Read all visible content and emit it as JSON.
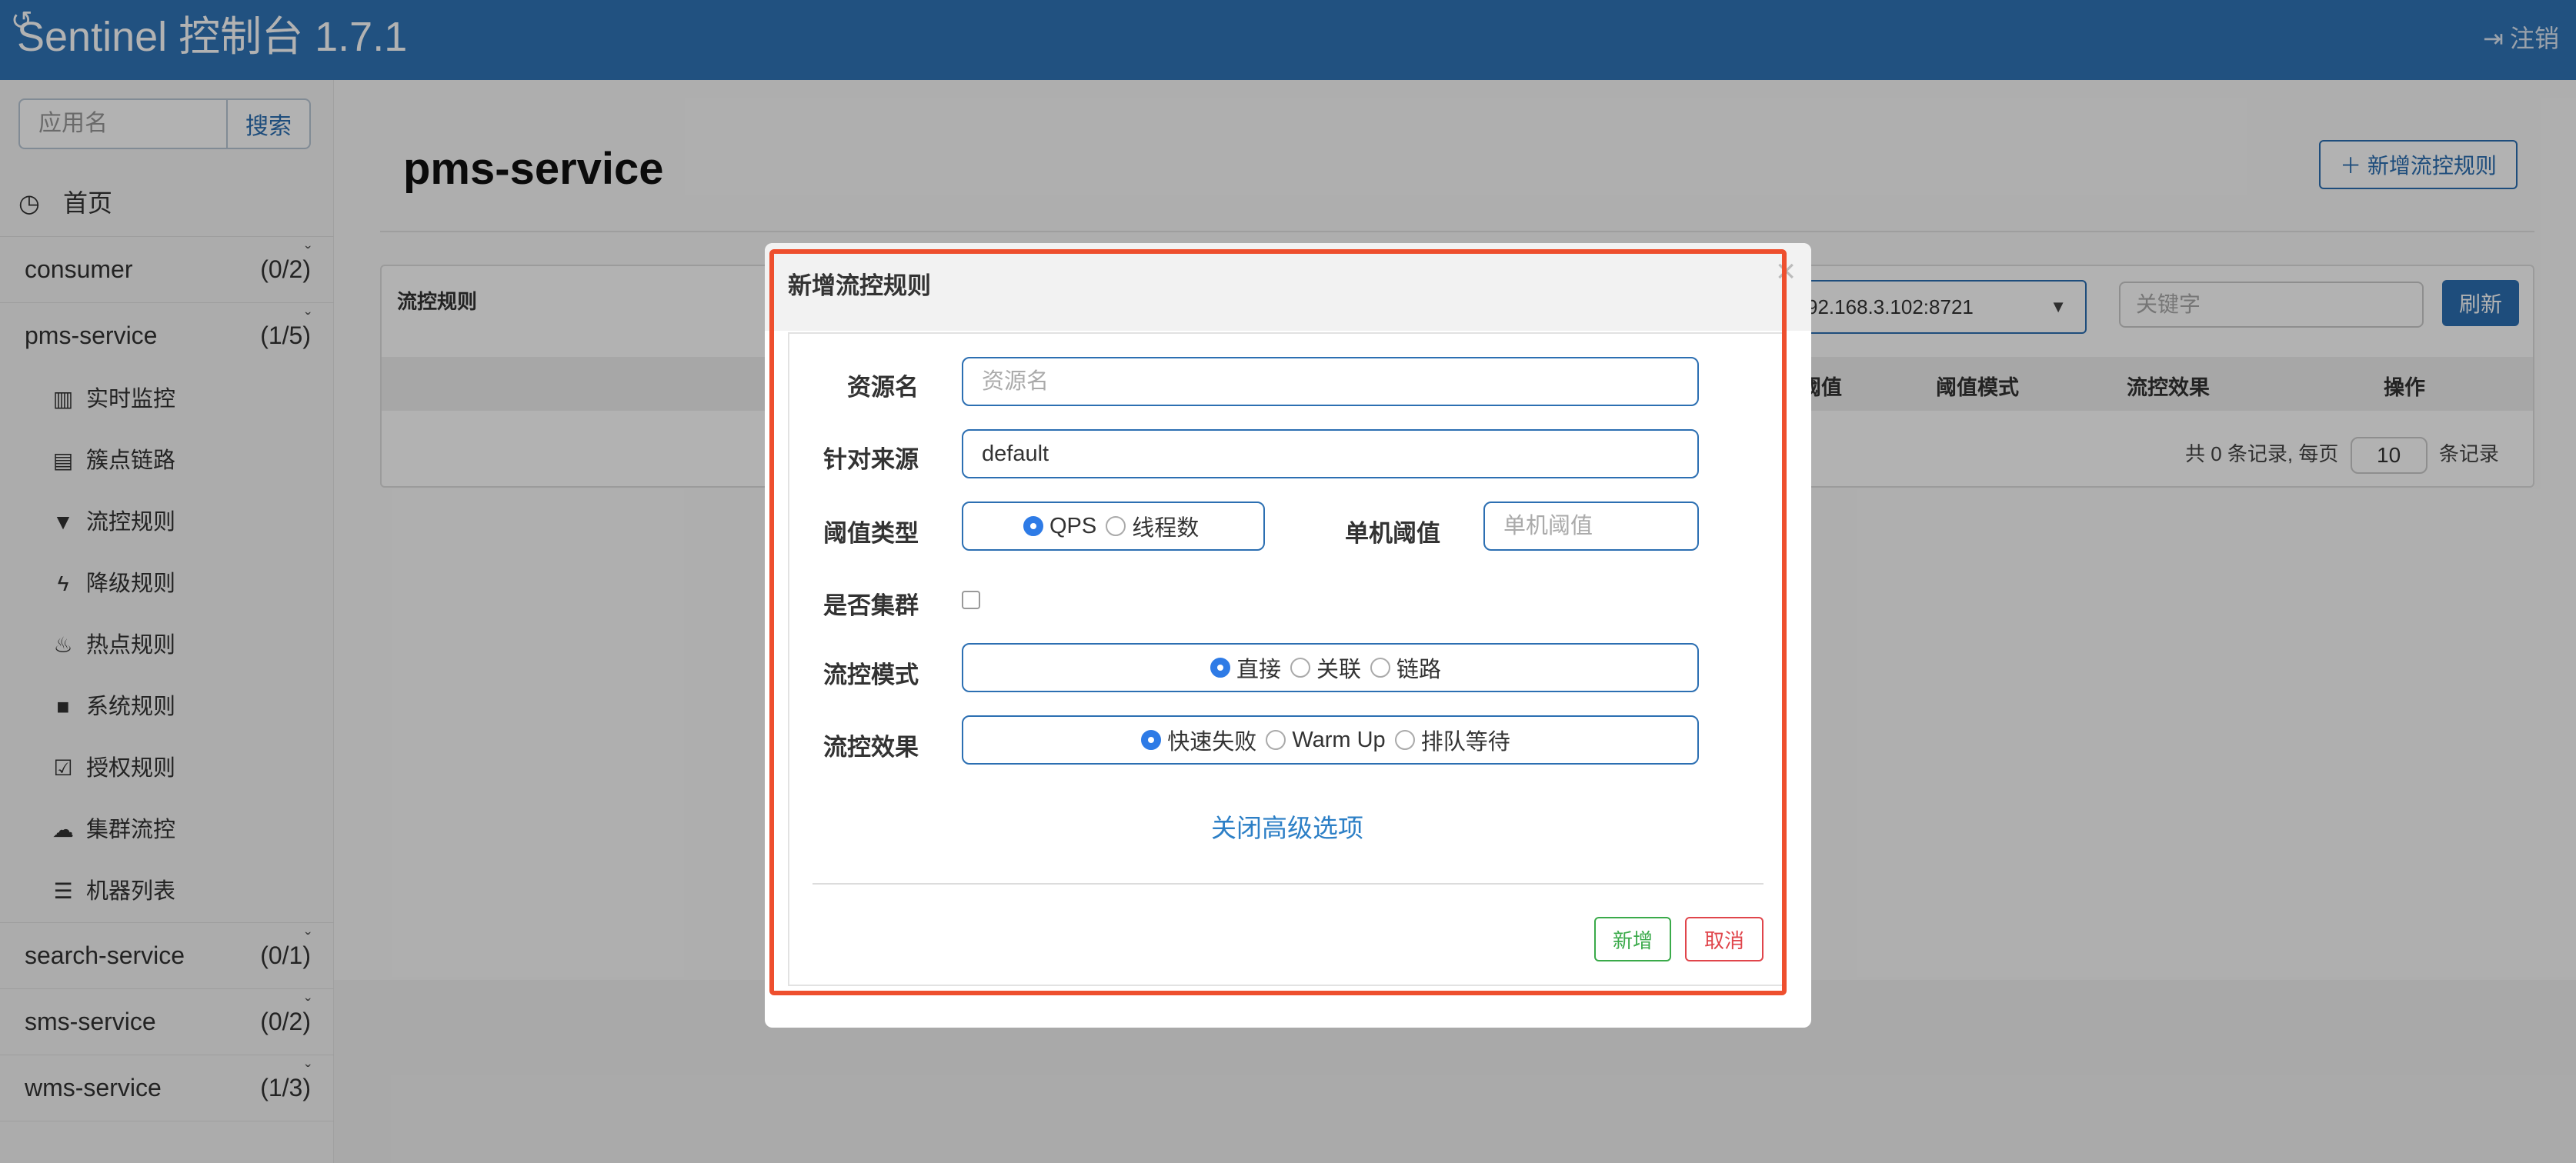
{
  "header": {
    "title": "Sentinel 控制台 1.7.1",
    "logout_label": "注销",
    "logout_icon": "logout-icon"
  },
  "sidebar": {
    "search_placeholder": "应用名",
    "search_button": "搜索",
    "home_label": "首页",
    "apps": [
      {
        "name": "consumer",
        "count": "(0/2)"
      },
      {
        "name": "pms-service",
        "count": "(1/5)"
      },
      {
        "name": "search-service",
        "count": "(0/1)"
      },
      {
        "name": "sms-service",
        "count": "(0/2)"
      },
      {
        "name": "wms-service",
        "count": "(1/3)"
      }
    ],
    "sub_items": [
      {
        "label": "实时监控",
        "icon": "bar-chart-icon"
      },
      {
        "label": "簇点链路",
        "icon": "list-icon"
      },
      {
        "label": "流控规则",
        "icon": "filter-icon"
      },
      {
        "label": "降级规则",
        "icon": "bolt-icon"
      },
      {
        "label": "热点规则",
        "icon": "fire-icon"
      },
      {
        "label": "系统规则",
        "icon": "lock-icon"
      },
      {
        "label": "授权规则",
        "icon": "check-icon"
      },
      {
        "label": "集群流控",
        "icon": "cloud-icon"
      },
      {
        "label": "机器列表",
        "icon": "th-list-icon"
      }
    ]
  },
  "main": {
    "page_title": "pms-service",
    "add_rule_button": "新增流控规则",
    "panel_title": "流控规则",
    "machine_select": "92.168.3.102:8721",
    "keyword_placeholder": "关键字",
    "refresh_button": "刷新",
    "columns": [
      "阈值",
      "阈值模式",
      "流控效果",
      "操作"
    ],
    "pager_prefix": "共 0 条记录, 每页",
    "page_size": "10",
    "pager_suffix": "条记录"
  },
  "modal": {
    "title": "新增流控规则",
    "close": "×",
    "resource_label": "资源名",
    "resource_placeholder": "资源名",
    "origin_label": "针对来源",
    "origin_value": "default",
    "threshold_type_label": "阈值类型",
    "threshold_type_options": [
      "QPS",
      "线程数"
    ],
    "threshold_type_selected": "QPS",
    "single_threshold_label": "单机阈值",
    "single_threshold_placeholder": "单机阈值",
    "cluster_label": "是否集群",
    "mode_label": "流控模式",
    "mode_options": [
      "直接",
      "关联",
      "链路"
    ],
    "mode_selected": "直接",
    "effect_label": "流控效果",
    "effect_options": [
      "快速失败",
      "Warm Up",
      "排队等待"
    ],
    "effect_selected": "快速失败",
    "advanced_link": "关闭高级选项",
    "add_button": "新增",
    "cancel_button": "取消",
    "highlight_color": "#ee4f2e"
  },
  "colors": {
    "topbar": "#3075b8",
    "primary": "#2c6fb2",
    "success": "#3aaa4a",
    "danger": "#e0454b"
  }
}
